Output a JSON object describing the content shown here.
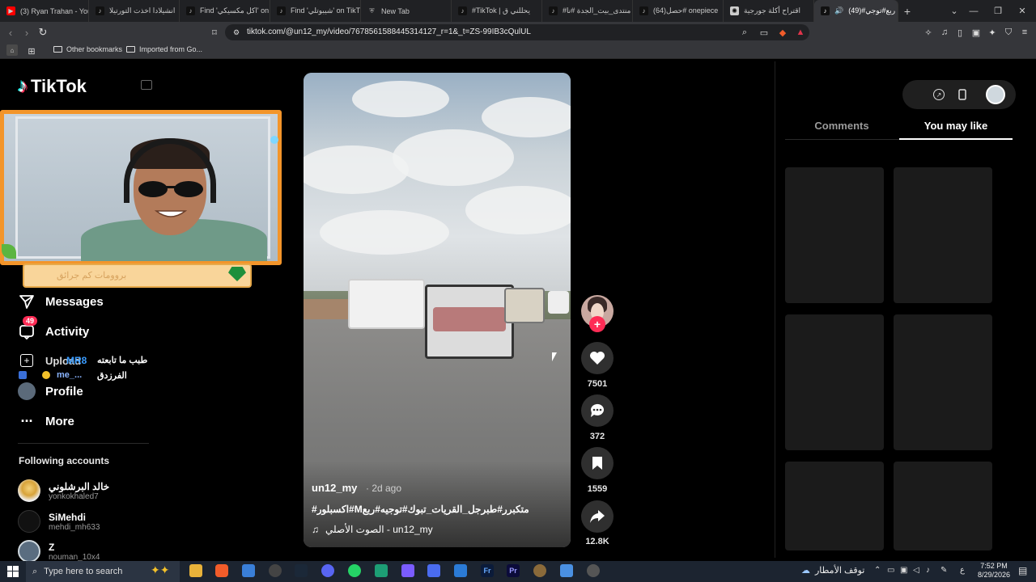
{
  "browser": {
    "tabs": [
      {
        "label": "(3) Ryan Trahan - YouT",
        "fav_color": "#ff0000",
        "icon": "youtube-icon"
      },
      {
        "label": "انشيلادا اخذت التورتيلا",
        "fav_color": "#111111",
        "icon": "tiktok-icon"
      },
      {
        "label": "Find 'اكل مكسيكي' on",
        "fav_color": "#111111",
        "icon": "tiktok-icon"
      },
      {
        "label": "Find 'شيبوتلي' on TikT",
        "fav_color": "#111111",
        "icon": "tiktok-icon"
      },
      {
        "label": "New Tab",
        "fav_color": "#888888",
        "icon": "shield-icon"
      },
      {
        "label": "#TikTok | يحللني ق",
        "fav_color": "#111111",
        "icon": "tiktok-icon"
      },
      {
        "label": "#منتدى_بيت_الجدة #نا",
        "fav_color": "#111111",
        "icon": "tiktok-icon"
      },
      {
        "label": "(64)حصل# onepiece",
        "fav_color": "#111111",
        "icon": "tiktok-icon"
      },
      {
        "label": "اقتراح أكلة جورجية",
        "fav_color": "#cccccc",
        "icon": "openai-icon"
      },
      {
        "label": "(49)#ربع#توجي",
        "fav_color": "#111111",
        "icon": "tiktok-icon",
        "active": true
      }
    ],
    "url": "tiktok.com/@un12_my/video/7678561588445314127_r=1&_t=ZS-99IB3cQulUL",
    "bookmarks": [
      "Other bookmarks",
      "Imported from Go..."
    ]
  },
  "sidebar": {
    "logo": "TikTok",
    "nav": [
      {
        "label": "Messages",
        "icon": "send-icon"
      },
      {
        "label": "Activity",
        "icon": "activity-icon",
        "badge": "49"
      },
      {
        "label": "Profile",
        "icon": "profile-icon"
      },
      {
        "label": "More",
        "icon": "more-icon"
      }
    ],
    "overlap_lines": [
      "طبب ما تابعته",
      "الفرزدق",
      "Upload",
      "MR8",
      "me_..."
    ],
    "following_header": "Following accounts",
    "following": [
      {
        "name": "خالد البرشلوني",
        "username": "yonkokhaled7"
      },
      {
        "name": "SiMehdi",
        "username": "mehdi_mh633"
      },
      {
        "name": "Z",
        "username": "nouman_10x4"
      }
    ]
  },
  "webcam": {
    "banner_text": "بروومات كم جرائق"
  },
  "video": {
    "author": "un12_my",
    "time": "· 2d ago",
    "caption": "#اكسبلور#Mمتكبرر#طبرجل_القريات_تبوك#توجيه#ربع",
    "music": "الصوت الأصلي - un12_my"
  },
  "actions": {
    "likes": "7501",
    "comments": "372",
    "saves": "1559",
    "shares": "12.8K"
  },
  "right_panel": {
    "tabs": [
      "Comments",
      "You may like"
    ],
    "active_tab": "You may like"
  },
  "taskbar": {
    "search_placeholder": "Type here to search",
    "weather": "توقف الأمطار",
    "time": "7:52 PM",
    "date": "8/29/2026"
  },
  "colors": {
    "tiktok_red": "#fe2c55",
    "overlay_orange": "#f3952a"
  }
}
